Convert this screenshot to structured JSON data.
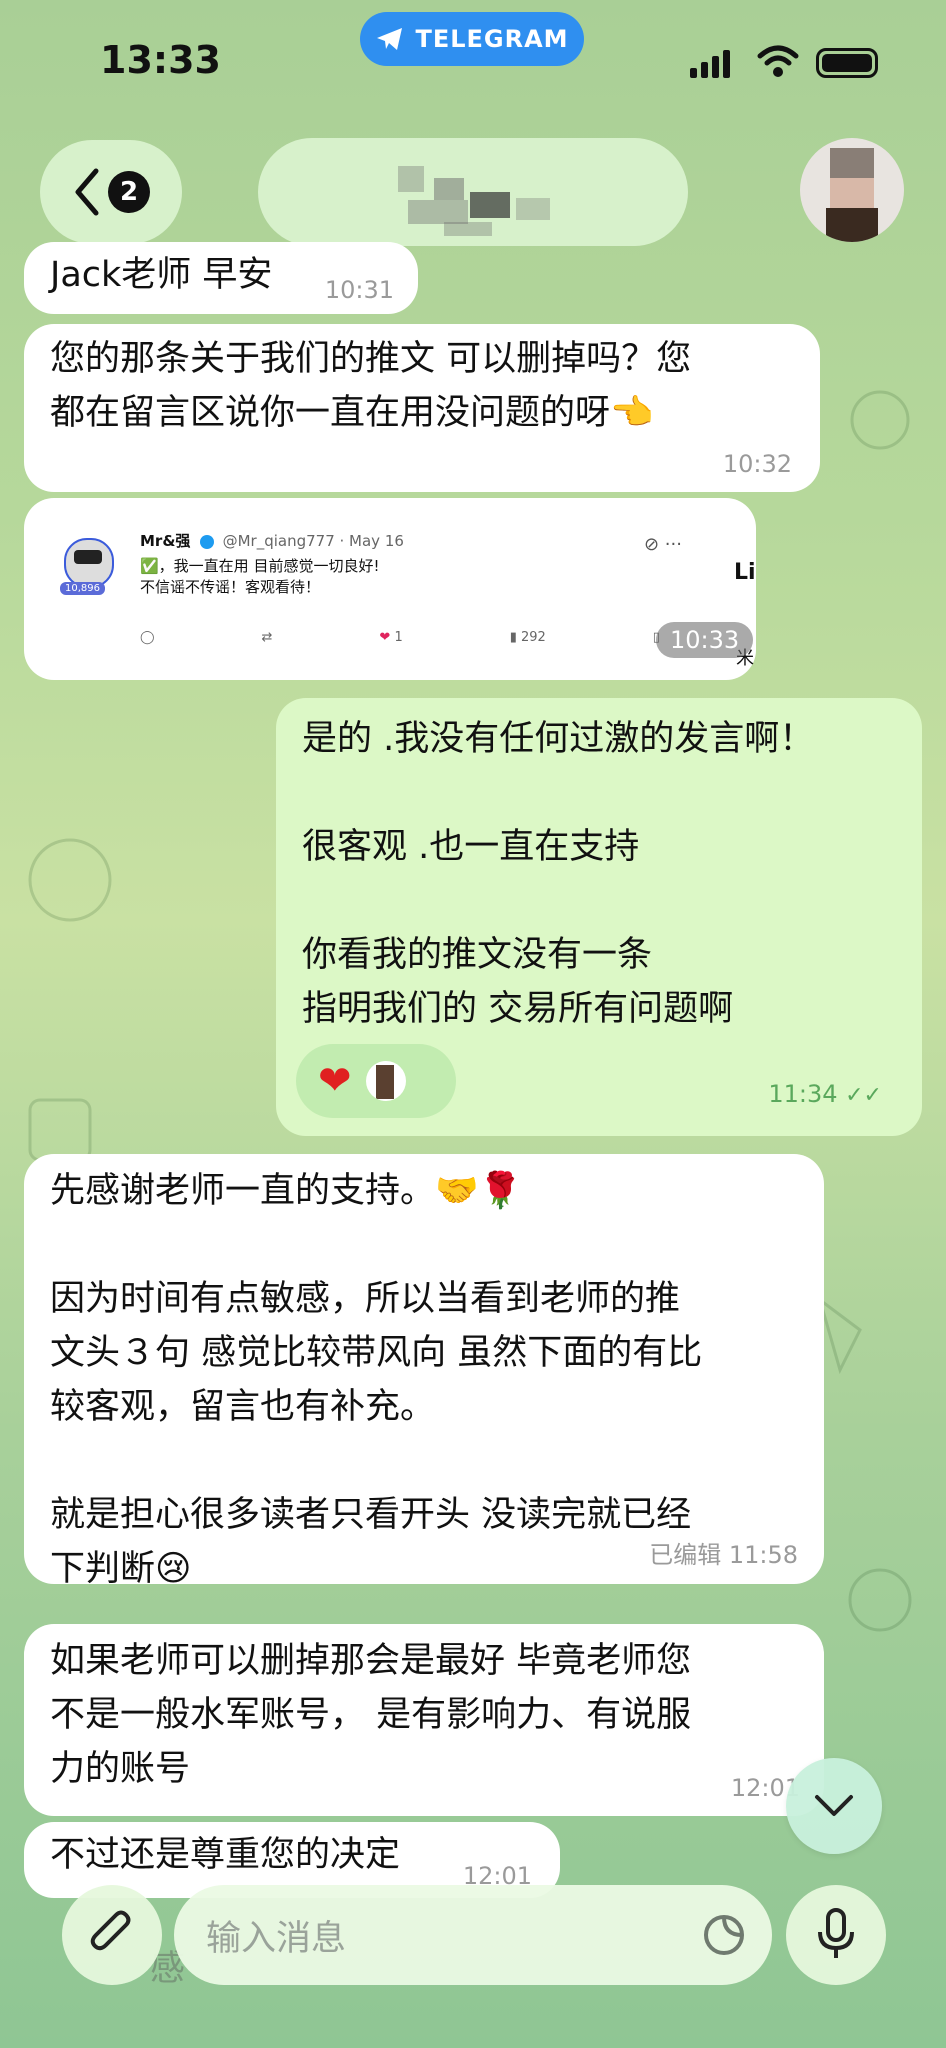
{
  "status_bar": {
    "time": "13:33",
    "app_pill": "TELEGRAM"
  },
  "header": {
    "back_count": "2"
  },
  "messages": [
    {
      "text": "Jack老师 早安",
      "time": "10:31"
    },
    {
      "text": "您的那条关于我们的推文 可以删掉吗？您\n都在留言区说你一直在用没问题的呀👈",
      "time": "10:32"
    },
    {
      "tweet": {
        "name": "Mr&强",
        "handle": "@Mr_qiang777 · May 16",
        "line1": "✅，我一直在用 目前感觉一切良好!",
        "line2": "不信谣不传谣！客观看待！",
        "badge": "10,896",
        "likes": "1",
        "views": "292",
        "side_text": "Li",
        "side_char": "米"
      },
      "time": "10:33"
    },
    {
      "text": "是的 .我没有任何过激的发言啊！\n\n很客观 .也一直在支持\n\n你看我的推文没有一条\n指明我们的 交易所有问题啊",
      "time": "11:34",
      "reaction": "❤",
      "outgoing": true
    },
    {
      "text": "先感谢老师一直的支持。🤝🌹\n\n因为时间有点敏感，所以当看到老师的推\n文头３句 感觉比较带风向 虽然下面的有比\n较客观，留言也有补充。\n\n就是担心很多读者只看开头 没读完就已经\n下判断😢",
      "time": "已编辑 11:58"
    },
    {
      "text": "如果老师可以删掉那会是最好 毕竟老师您\n不是一般水军账号， 是有影响力、有说服\n力的账号",
      "time": "12:01"
    },
    {
      "text": "不过还是尊重您的决定",
      "time": "12:01"
    }
  ],
  "input": {
    "placeholder": "输入消息"
  },
  "background_fragment": "感",
  "icons": [
    "back-chevron-icon",
    "telegram-plane-icon",
    "signal-icon",
    "wifi-icon",
    "battery-icon",
    "paperclip-icon",
    "sticker-icon",
    "microphone-icon",
    "chevron-down-icon",
    "heart-icon",
    "read-checks-icon"
  ],
  "colors": {
    "incoming_bubble": "#ffffff",
    "outgoing_bubble": "#dcf8c6",
    "telegram_blue": "#2f8ff0",
    "read_check": "#5aa85c"
  }
}
